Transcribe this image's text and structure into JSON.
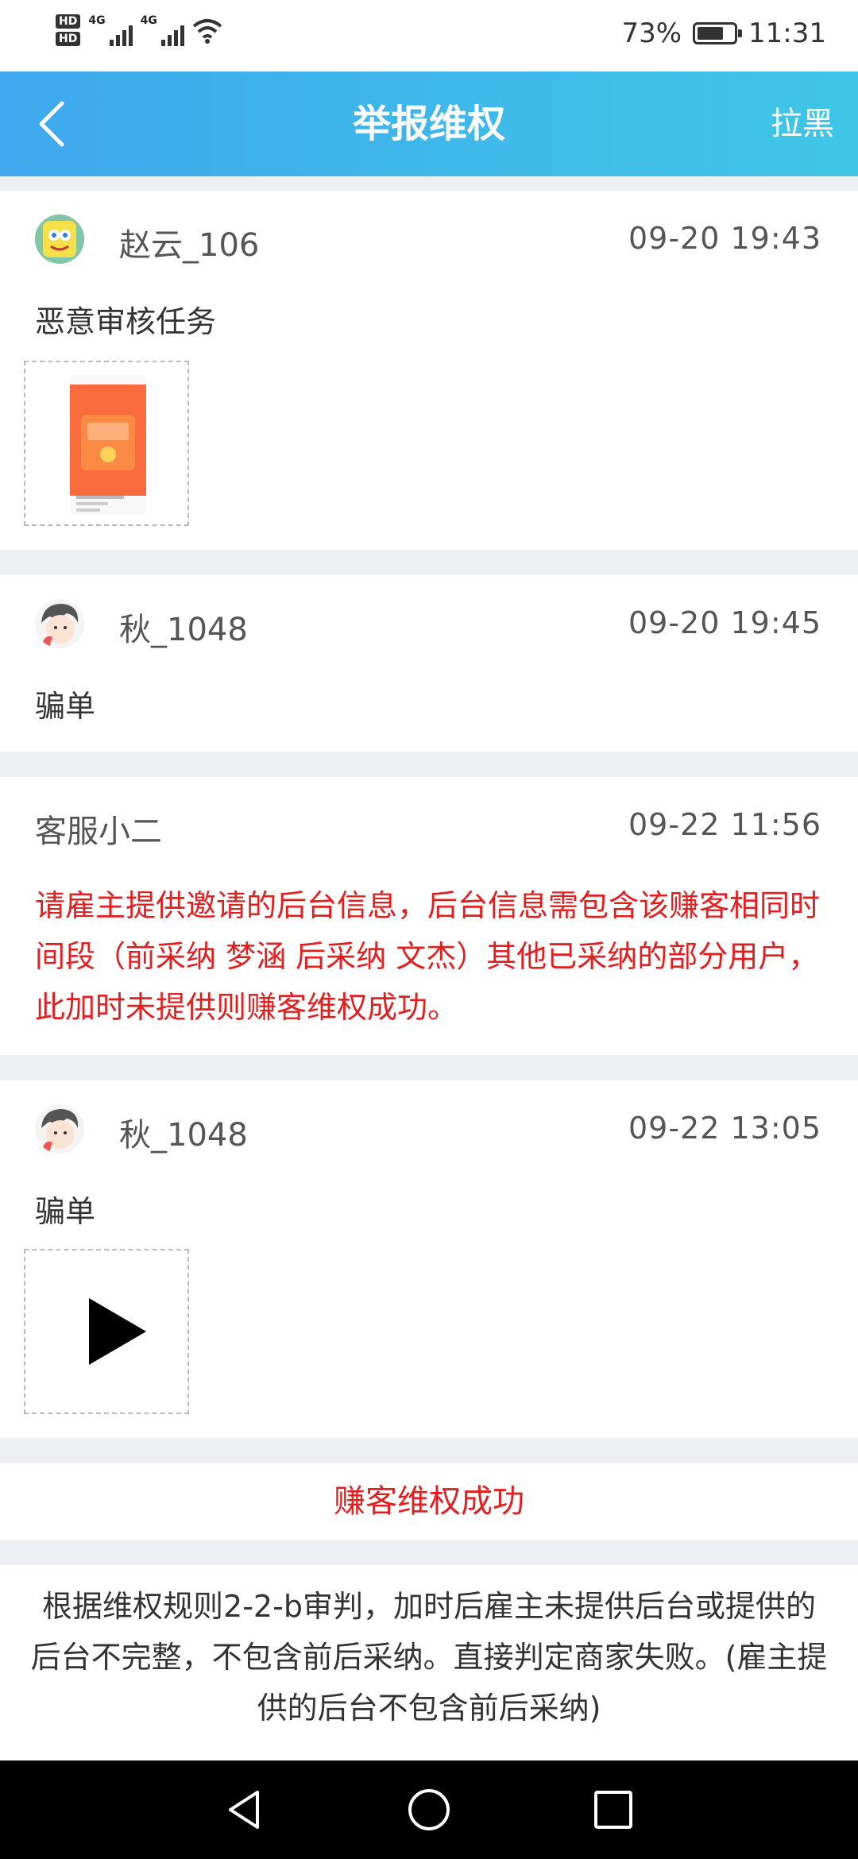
{
  "status_bar": {
    "hd1": "HD",
    "hd2": "HD",
    "sim1_label": "4G",
    "sim2_label": "4G",
    "battery_percent": "73%",
    "battery_level": 0.73,
    "time": "11:31"
  },
  "nav": {
    "title": "举报维权",
    "action": "拉黑",
    "back_icon": "chevron-left-icon"
  },
  "posts": [
    {
      "user": "赵云_106",
      "time": "09-20 19:43",
      "text": "恶意审核任务",
      "attachment": "image"
    },
    {
      "user": "秋_1048",
      "time": "09-20 19:45",
      "text": "骗单"
    },
    {
      "user": "客服小二",
      "time": "09-22 11:56",
      "text": "请雇主提供邀请的后台信息，后台信息需包含该赚客相同时间段（前采纳 梦涵 后采纳 文杰）其他已采纳的部分用户，此加时未提供则赚客维权成功。"
    },
    {
      "user": "秋_1048",
      "time": "09-22 13:05",
      "text": "骗单",
      "attachment": "video"
    }
  ],
  "result": "赚客维权成功",
  "rule_text": "根据维权规则2-2-b审判，加时后雇主未提供后台或提供的后台不完整，不包含前后采纳。直接判定商家失败。(雇主提供的后台不包含前后采纳)",
  "colors": {
    "nav_gradient_start": "#3fa8ee",
    "nav_gradient_end": "#3fc6e6",
    "alert_red": "#e02020"
  }
}
